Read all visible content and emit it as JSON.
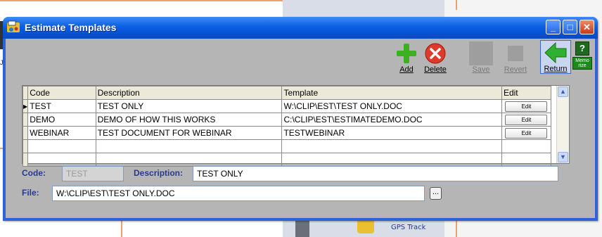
{
  "window": {
    "title": "Estimate Templates",
    "minimize_glyph": "_",
    "maximize_glyph": "□",
    "close_glyph": "✕"
  },
  "toolbar": {
    "add_label": "Add",
    "delete_label": "Delete",
    "save_label": "Save",
    "revert_label": "Revert",
    "return_label": "Return",
    "memorize_label": "Memo rize"
  },
  "grid": {
    "columns": [
      "Code",
      "Description",
      "Template",
      "Edit"
    ],
    "rows": [
      {
        "code": "TEST",
        "description": "TEST ONLY",
        "template": "W:\\CLIP\\EST\\TEST ONLY.DOC",
        "edit": "Edit",
        "selected": true
      },
      {
        "code": "DEMO",
        "description": "DEMO OF HOW THIS WORKS",
        "template": "C:\\CLIP\\EST\\ESTIMATEDEMO.DOC",
        "edit": "Edit",
        "selected": false
      },
      {
        "code": "WEBINAR",
        "description": "TEST DOCUMENT FOR WEBINAR",
        "template": "TESTWEBINAR",
        "edit": "Edit",
        "selected": false
      }
    ]
  },
  "form": {
    "code_label": "Code:",
    "code_value": "TEST",
    "description_label": "Description:",
    "description_value": "TEST ONLY",
    "file_label": "File:",
    "file_value": "W:\\CLIP\\EST\\TEST ONLY.DOC",
    "browse_label": "..."
  },
  "background": {
    "left_caption": "Job",
    "gps_label": "GPS Track"
  },
  "colors": {
    "title_bar": "#0a5fe0",
    "client_bg": "#b5b5b5",
    "label_text": "#2a3a8a",
    "add_green": "#3cb020",
    "delete_red": "#e03a2a",
    "return_green": "#2fb030"
  }
}
